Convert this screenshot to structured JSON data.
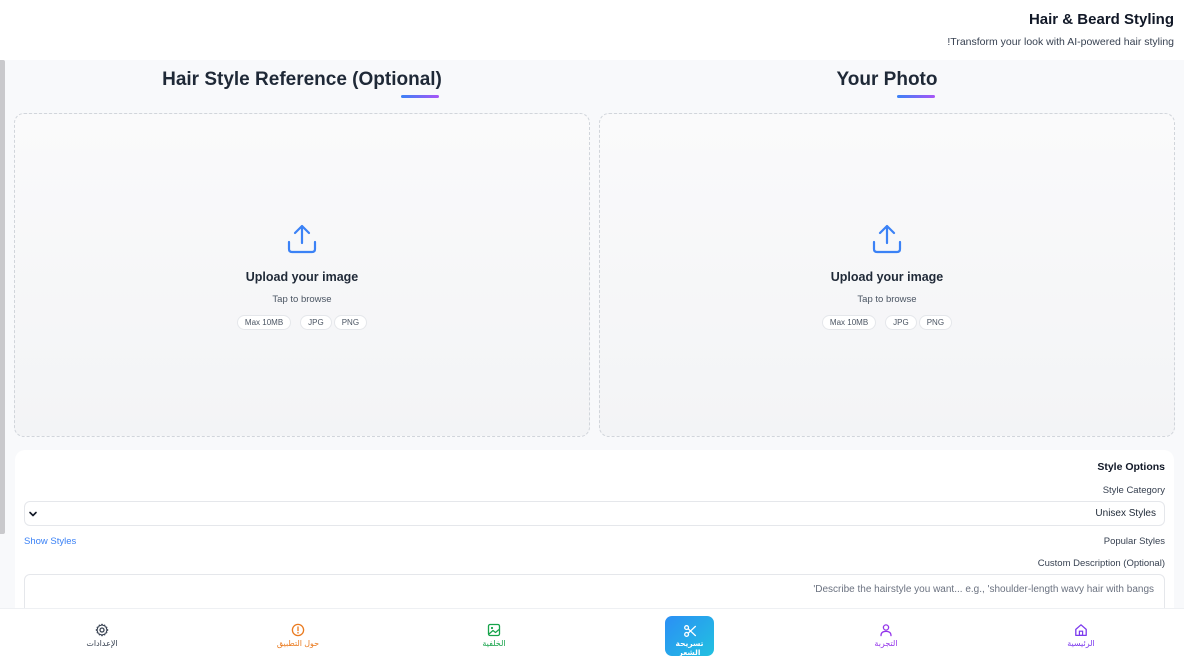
{
  "header": {
    "title": "Hair & Beard Styling",
    "subtitle": "Transform your look with AI-powered hair styling!"
  },
  "reference": {
    "title": "Hair Style Reference (Optional)",
    "upload_title": "Upload your image",
    "upload_hint": "Tap to browse",
    "chips": [
      "Max 10MB",
      "JPG",
      "PNG"
    ]
  },
  "photo": {
    "title": "Your Photo",
    "upload_title": "Upload your image",
    "upload_hint": "Tap to browse",
    "chips": [
      "Max 10MB",
      "JPG",
      "PNG"
    ]
  },
  "options": {
    "heading": "Style Options",
    "category_label": "Style Category",
    "category_value": "Unisex Styles",
    "show_styles": "Show Styles",
    "popular_label": "Popular Styles",
    "custom_label": "Custom Description (Optional)",
    "custom_placeholder": "Describe the hairstyle you want... e.g., 'shoulder-length wavy hair with bangs'"
  },
  "nav": {
    "settings": "الإعدادات",
    "about": "حول التطبيق",
    "background": "الخلفية",
    "hair": "تسريحة الشعر",
    "tryon": "التجربة",
    "home": "الرئيسية"
  },
  "colors": {
    "accent_blue": "#3b82f6",
    "accent_purple": "#a855f7",
    "nav_about": "#ea7a1e",
    "nav_background": "#16a34a",
    "nav_tryon": "#9333ea",
    "nav_home": "#7c3aed"
  },
  "icons": {
    "upload": "upload-icon",
    "settings": "gear-icon",
    "about": "info-icon",
    "background": "image-icon",
    "hair": "scissors-icon",
    "tryon": "user-icon",
    "home": "home-icon",
    "select": "chevron-down-icon"
  }
}
